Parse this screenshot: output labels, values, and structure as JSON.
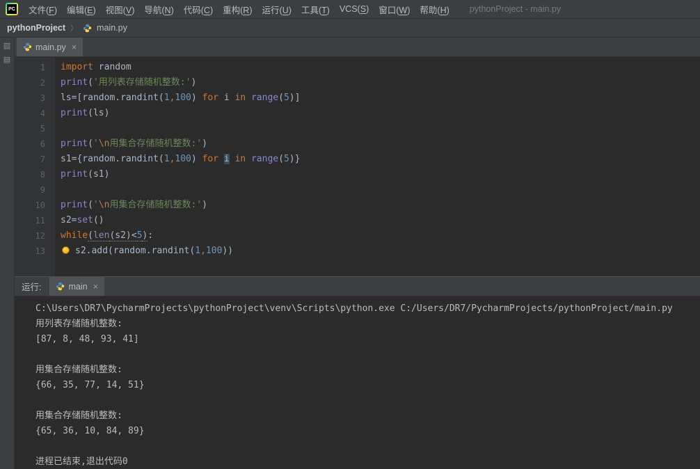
{
  "colors": {
    "kw": "#cc7832",
    "builtin": "#8888c6",
    "str": "#6a8759",
    "esc": "#cc7832",
    "num": "#6897bb",
    "plain": "#a9b7c6"
  },
  "app": {
    "logo_text": "PC",
    "title": "pythonProject - main.py",
    "menus": [
      {
        "label": "文件",
        "mnemonic": "F"
      },
      {
        "label": "编辑",
        "mnemonic": "E"
      },
      {
        "label": "视图",
        "mnemonic": "V"
      },
      {
        "label": "导航",
        "mnemonic": "N"
      },
      {
        "label": "代码",
        "mnemonic": "C"
      },
      {
        "label": "重构",
        "mnemonic": "R"
      },
      {
        "label": "运行",
        "mnemonic": "U"
      },
      {
        "label": "工具",
        "mnemonic": "T"
      },
      {
        "label": "VCS",
        "mnemonic": "S"
      },
      {
        "label": "窗口",
        "mnemonic": "W"
      },
      {
        "label": "帮助",
        "mnemonic": "H"
      }
    ]
  },
  "breadcrumb": {
    "project": "pythonProject",
    "separator": "〉",
    "file": "main.py"
  },
  "editor": {
    "tab_label": "main.py",
    "close_glyph": "×",
    "lines": [
      [
        [
          "import",
          "kw"
        ],
        [
          " random",
          "plain"
        ]
      ],
      [
        [
          "print",
          "builtin"
        ],
        [
          "(",
          "plain"
        ],
        [
          "'用列表存储随机整数:'",
          "str"
        ],
        [
          ")",
          "plain"
        ]
      ],
      [
        [
          "ls=[random.randint(",
          "plain"
        ],
        [
          "1",
          "num"
        ],
        [
          ",",
          "kw"
        ],
        [
          "100",
          "num"
        ],
        [
          ") ",
          "plain"
        ],
        [
          "for",
          "kw"
        ],
        [
          " i ",
          "plain"
        ],
        [
          "in",
          "kw"
        ],
        [
          " ",
          "plain"
        ],
        [
          "range",
          "builtin"
        ],
        [
          "(",
          "plain"
        ],
        [
          "5",
          "num"
        ],
        [
          ")]",
          "plain"
        ]
      ],
      [
        [
          "print",
          "builtin"
        ],
        [
          "(ls)",
          "plain"
        ]
      ],
      [],
      [
        [
          "print",
          "builtin"
        ],
        [
          "(",
          "plain"
        ],
        [
          "'",
          "str"
        ],
        [
          "\\n",
          "esc"
        ],
        [
          "用集合存储随机整数:'",
          "str"
        ],
        [
          ")",
          "plain"
        ]
      ],
      [
        [
          "s1={random.randint(",
          "plain"
        ],
        [
          "1",
          "num"
        ],
        [
          ",",
          "kw"
        ],
        [
          "100",
          "num"
        ],
        [
          ") ",
          "plain"
        ],
        [
          "for",
          "kw"
        ],
        [
          " ",
          "plain"
        ],
        [
          "i",
          "plain hl"
        ],
        [
          " ",
          "plain"
        ],
        [
          "in",
          "kw"
        ],
        [
          " ",
          "plain"
        ],
        [
          "range",
          "builtin"
        ],
        [
          "(",
          "plain"
        ],
        [
          "5",
          "num"
        ],
        [
          ")}",
          "plain"
        ]
      ],
      [
        [
          "print",
          "builtin"
        ],
        [
          "(s1)",
          "plain"
        ]
      ],
      [],
      [
        [
          "print",
          "builtin"
        ],
        [
          "(",
          "plain"
        ],
        [
          "'",
          "str"
        ],
        [
          "\\n",
          "esc"
        ],
        [
          "用集合存储随机整数:'",
          "str"
        ],
        [
          ")",
          "plain"
        ]
      ],
      [
        [
          "s2=",
          "plain"
        ],
        [
          "set",
          "builtin"
        ],
        [
          "()",
          "plain"
        ]
      ],
      [
        [
          "while",
          "kw"
        ],
        [
          "(",
          "plain ul"
        ],
        [
          "len",
          "builtin ul"
        ],
        [
          "(s2)<",
          "plain ul"
        ],
        [
          "5",
          "num ul"
        ],
        [
          ")",
          "plain ul"
        ],
        [
          ":",
          "plain"
        ]
      ],
      [
        [
          "",
          "bulb"
        ],
        [
          "s2.add(random.randint(",
          "plain"
        ],
        [
          "1",
          "num"
        ],
        [
          ",",
          "kw"
        ],
        [
          "100",
          "num"
        ],
        [
          "))",
          "plain"
        ]
      ]
    ]
  },
  "run": {
    "label": "运行:",
    "tab_label": "main",
    "close_glyph": "×",
    "console_lines": [
      "C:\\Users\\DR7\\PycharmProjects\\pythonProject\\venv\\Scripts\\python.exe C:/Users/DR7/PycharmProjects/pythonProject/main.py",
      "用列表存储随机整数:",
      "[87, 8, 48, 93, 41]",
      "",
      "用集合存储随机整数:",
      "{66, 35, 77, 14, 51}",
      "",
      "用集合存储随机整数:",
      "{65, 36, 10, 84, 89}",
      "",
      "进程已结束,退出代码0"
    ]
  }
}
